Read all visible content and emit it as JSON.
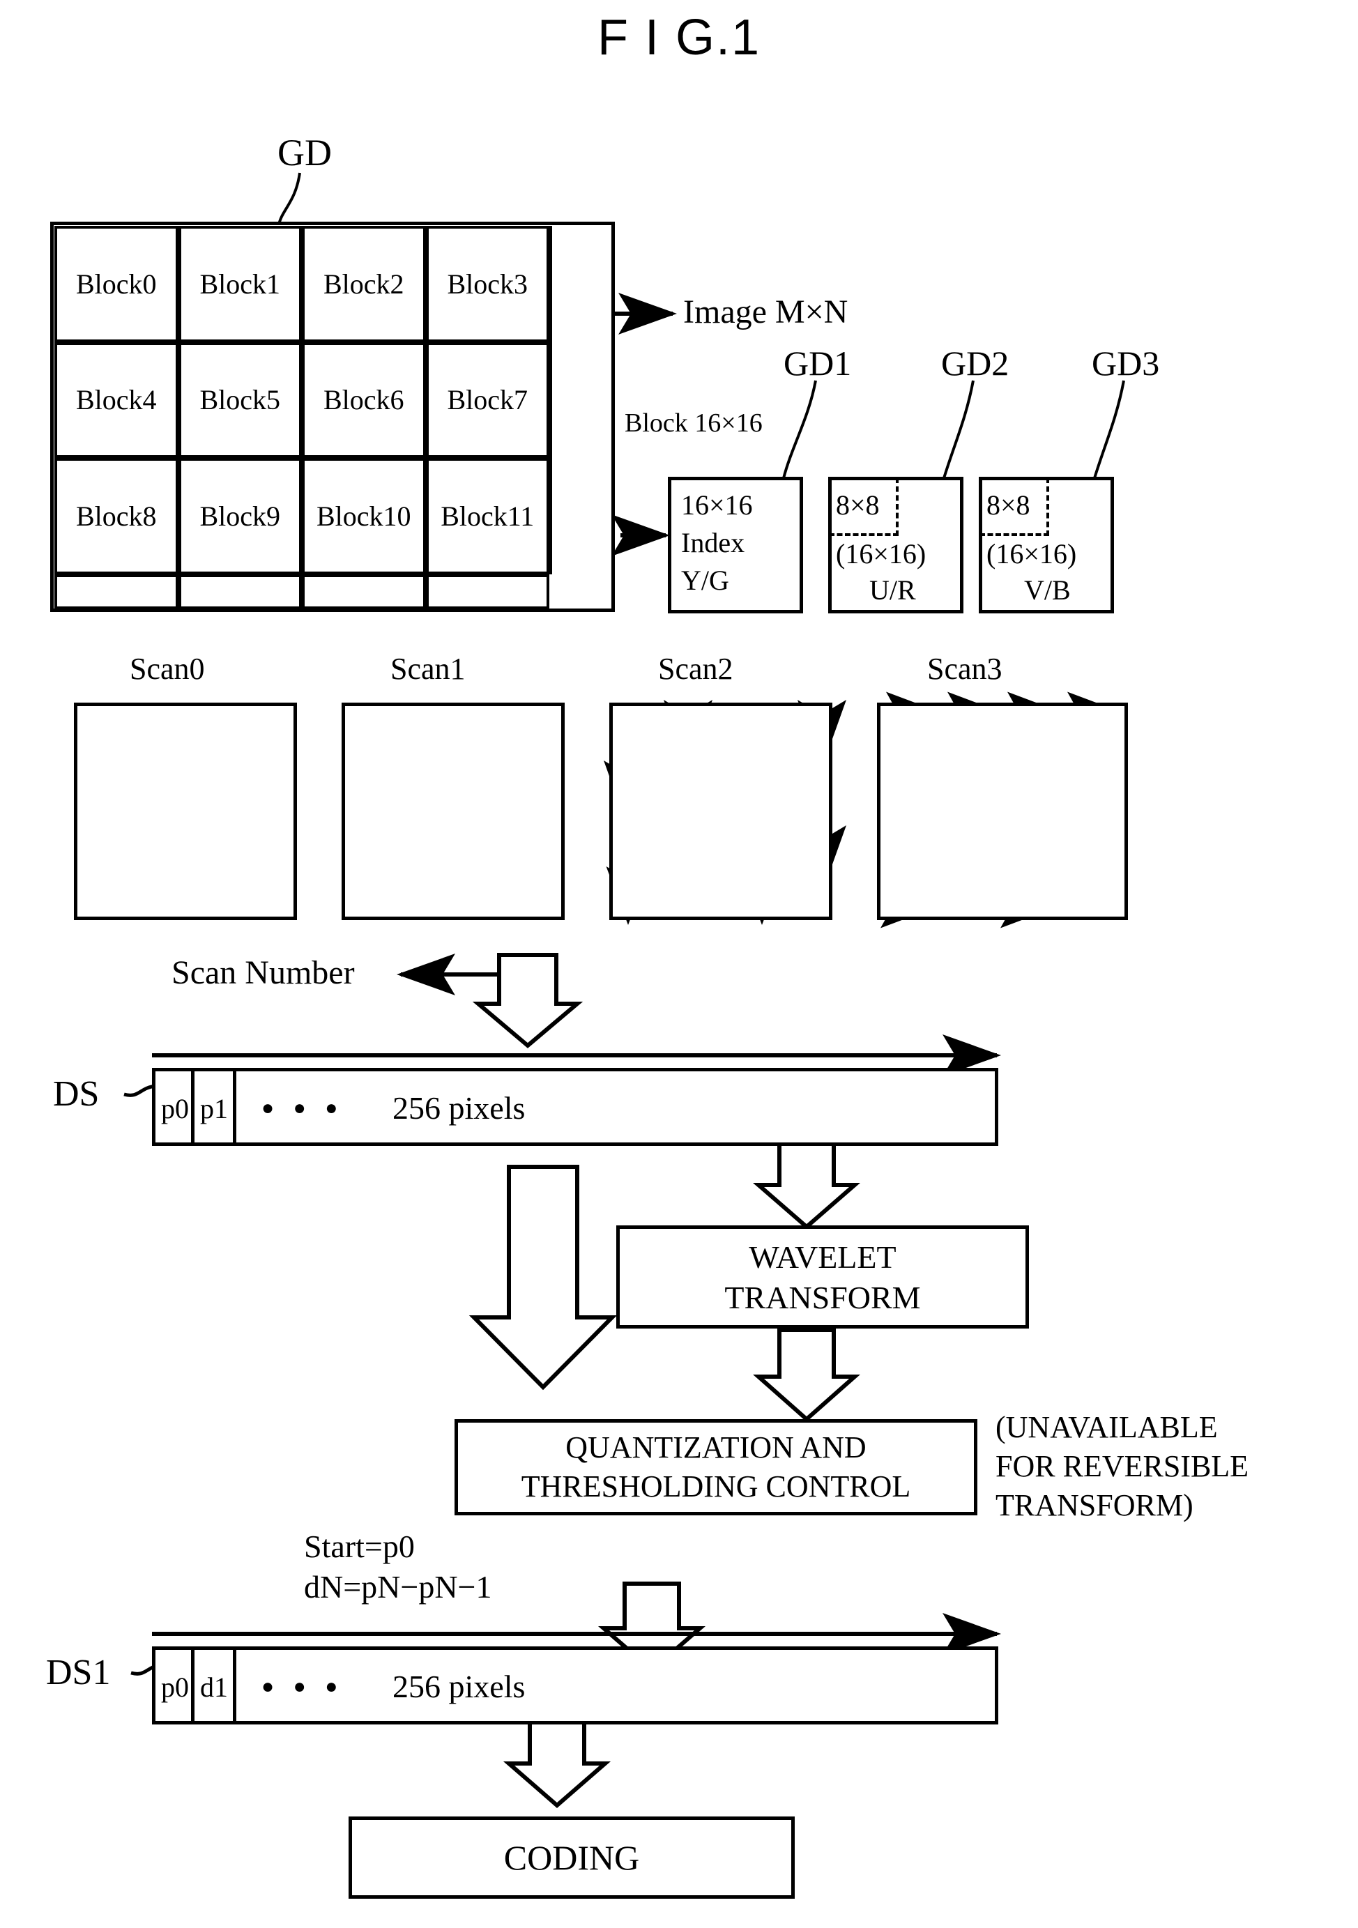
{
  "figure": {
    "title": "F I G.1"
  },
  "image_grid": {
    "pointer_label": "GD",
    "image_label": "Image M×N",
    "block_label": "Block 16×16",
    "blocks": [
      "Block0",
      "Block1",
      "Block2",
      "Block3",
      "Block4",
      "Block5",
      "Block6",
      "Block7",
      "Block8",
      "Block9",
      "Block10",
      "Block11"
    ]
  },
  "component_planes": [
    {
      "pointer_label": "GD1",
      "lines": [
        "16×16",
        "Index",
        "Y/G"
      ],
      "inner_size": "",
      "has_dashed_inner": false
    },
    {
      "pointer_label": "GD2",
      "lines": [
        "8×8",
        "(16×16)",
        "U/R"
      ],
      "inner_size": "8×8",
      "has_dashed_inner": true
    },
    {
      "pointer_label": "GD3",
      "lines": [
        "8×8",
        "(16×16)",
        "V/B"
      ],
      "inner_size": "8×8",
      "has_dashed_inner": true
    }
  ],
  "scans": [
    {
      "label": "Scan0",
      "pattern": "horizontal-raster"
    },
    {
      "label": "Scan1",
      "pattern": "vertical-raster"
    },
    {
      "label": "Scan2",
      "pattern": "vertical-comb-2col"
    },
    {
      "label": "Scan3",
      "pattern": "horizontal-comb-4col"
    }
  ],
  "scan_number_label": "Scan Number",
  "data_stream_1": {
    "name": "DS",
    "cells": [
      "p0",
      "p1"
    ],
    "ellipsis": "● ● ●",
    "length_label": "256 pixels"
  },
  "wavelet_box": {
    "line1": "WAVELET",
    "line2": "TRANSFORM"
  },
  "quantization_box": {
    "line1": "QUANTIZATION AND",
    "line2": "THRESHOLDING CONTROL"
  },
  "note": {
    "line1": "(UNAVAILABLE",
    "line2": "FOR REVERSIBLE",
    "line3": "TRANSFORM)"
  },
  "delta_formula": {
    "line1": "Start=p0",
    "line2": "dN=pN−pN−1"
  },
  "data_stream_2": {
    "name": "DS1",
    "cells": [
      "p0",
      "d1"
    ],
    "ellipsis": "● ● ●",
    "length_label": "256 pixels"
  },
  "coding_box": {
    "label": "CODING"
  }
}
